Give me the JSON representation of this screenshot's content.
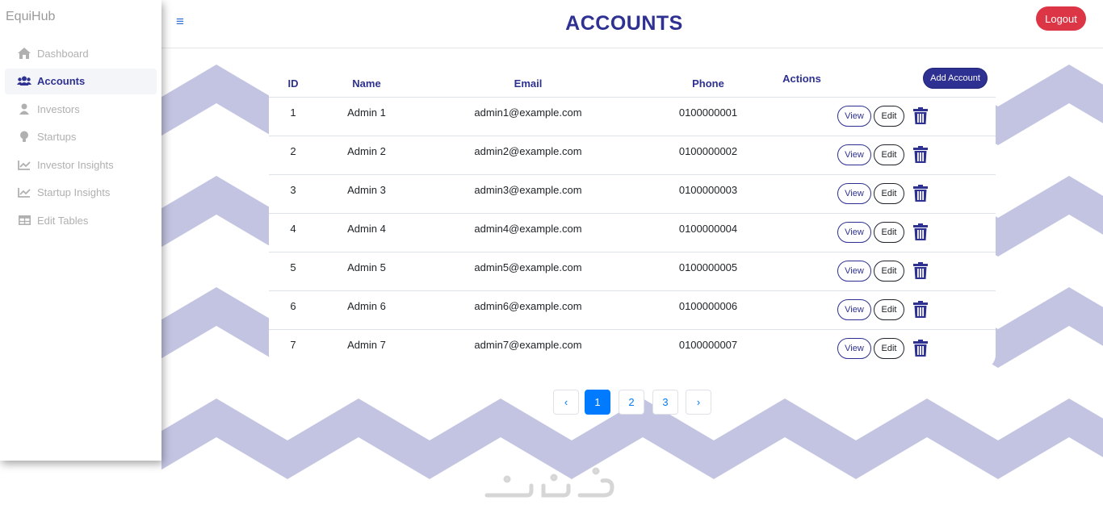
{
  "app": {
    "brand": "EquiHub"
  },
  "sidebar": {
    "items": [
      {
        "label": "Dashboard",
        "icon": "home-icon",
        "active": false
      },
      {
        "label": "Accounts",
        "icon": "users-icon",
        "active": true
      },
      {
        "label": "Investors",
        "icon": "user-icon",
        "active": false
      },
      {
        "label": "Startups",
        "icon": "lightbulb-icon",
        "active": false
      },
      {
        "label": "Investor Insights",
        "icon": "chart-line-icon",
        "active": false
      },
      {
        "label": "Startup Insights",
        "icon": "chart-line-icon",
        "active": false
      },
      {
        "label": "Edit Tables",
        "icon": "table-icon",
        "active": false
      }
    ]
  },
  "header": {
    "menu_icon": "≡",
    "title": "ACCOUNTS",
    "logout_label": "Logout"
  },
  "table": {
    "columns": {
      "id": "ID",
      "name": "Name",
      "email": "Email",
      "phone": "Phone",
      "actions": "Actions"
    },
    "add_label": "Add Account",
    "view_label": "View",
    "edit_label": "Edit",
    "rows": [
      {
        "id": "1",
        "name": "Admin 1",
        "email": "admin1@example.com",
        "phone": "0100000001"
      },
      {
        "id": "2",
        "name": "Admin 2",
        "email": "admin2@example.com",
        "phone": "0100000002"
      },
      {
        "id": "3",
        "name": "Admin 3",
        "email": "admin3@example.com",
        "phone": "0100000003"
      },
      {
        "id": "4",
        "name": "Admin 4",
        "email": "admin4@example.com",
        "phone": "0100000004"
      },
      {
        "id": "5",
        "name": "Admin 5",
        "email": "admin5@example.com",
        "phone": "0100000005"
      },
      {
        "id": "6",
        "name": "Admin 6",
        "email": "admin6@example.com",
        "phone": "0100000006"
      },
      {
        "id": "7",
        "name": "Admin 7",
        "email": "admin7@example.com",
        "phone": "0100000007"
      }
    ]
  },
  "pagination": {
    "prev": "‹",
    "pages": [
      "1",
      "2",
      "3"
    ],
    "current": "1",
    "next": "›"
  },
  "colors": {
    "primary": "#2e3192",
    "danger": "#dc3545",
    "page_active": "#007bff",
    "pattern": "#c3c4e2"
  }
}
